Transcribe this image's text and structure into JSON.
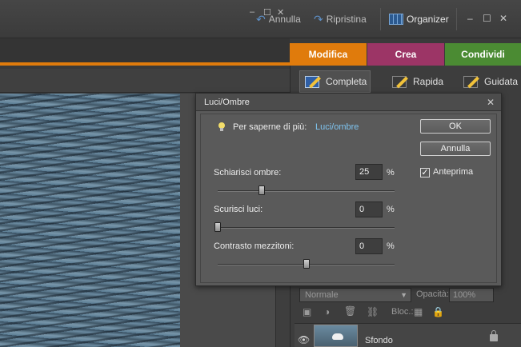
{
  "titlebar": {
    "undo_label": "Annulla",
    "redo_label": "Ripristina",
    "organizer_label": "Organizer",
    "minimize": "–",
    "maximize": "☐",
    "close": "✕"
  },
  "mode_tabs": [
    {
      "label": "Modifica",
      "color": "#e07b0c"
    },
    {
      "label": "Crea",
      "color": "#9c3566"
    },
    {
      "label": "Condividi",
      "color": "#4b8b33"
    }
  ],
  "document": {
    "min": "–",
    "max": "☐",
    "close": "✕"
  },
  "edit_modes": [
    {
      "label": "Completa",
      "active": true
    },
    {
      "label": "Rapida",
      "active": false
    },
    {
      "label": "Guidata",
      "active": false
    }
  ],
  "layers": {
    "blend_mode": "Normale",
    "opacity_label": "Opacità:",
    "opacity_value": "100%",
    "lock_label": "Bloc.:",
    "layer_name": "Sfondo"
  },
  "dialog": {
    "title": "Luci/Ombre",
    "learn_more": "Per saperne di più:",
    "learn_link": "Luci/ombre",
    "ok_label": "OK",
    "cancel_label": "Annulla",
    "preview_label": "Anteprima",
    "preview_checked": true,
    "sliders": [
      {
        "label": "Schiarisci ombre:",
        "value": "25",
        "unit": "%",
        "level": 25
      },
      {
        "label": "Scurisci luci:",
        "value": "0",
        "unit": "%",
        "level": 0
      },
      {
        "label": "Contrasto mezzitoni:",
        "value": "0",
        "unit": "%",
        "level": 50
      }
    ]
  }
}
